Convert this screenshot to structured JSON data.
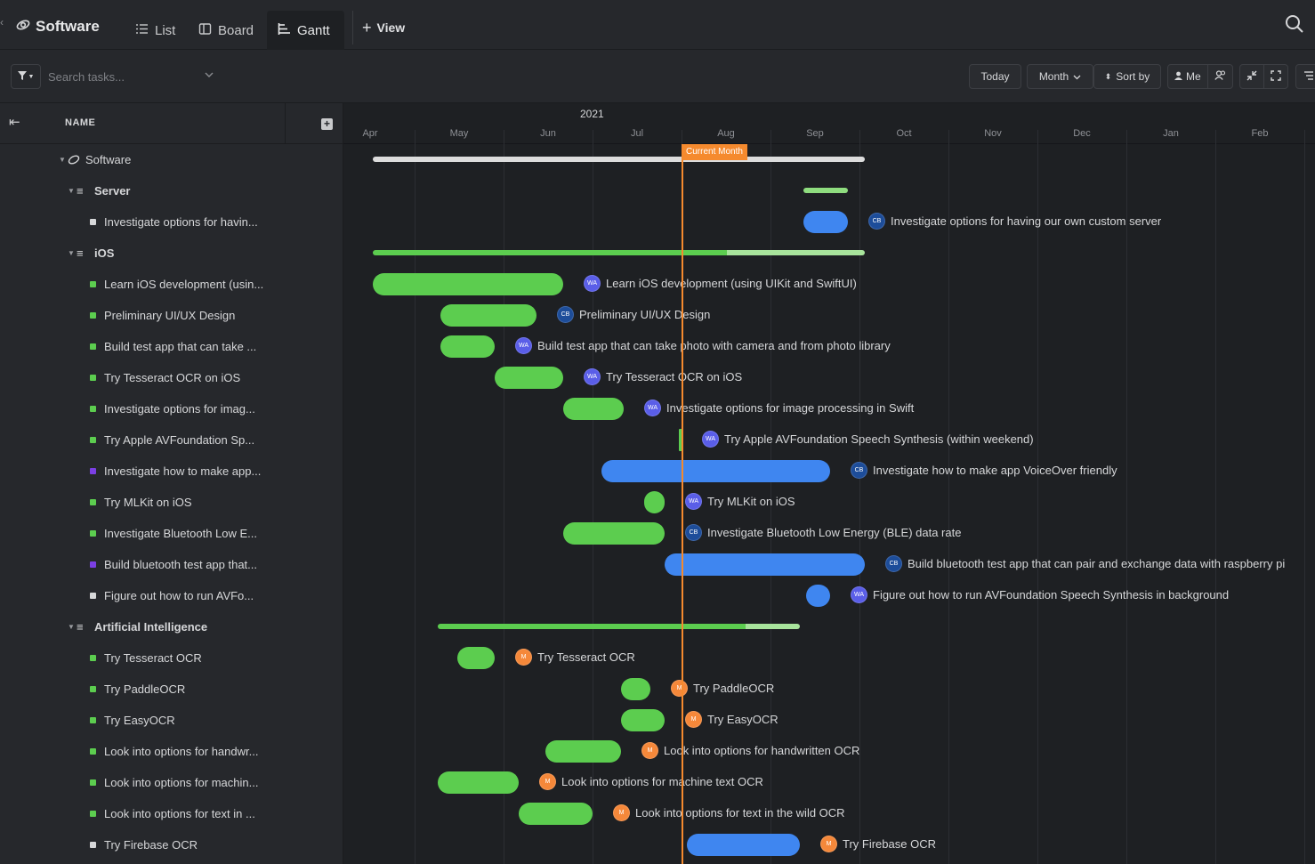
{
  "app": {
    "title": "Software",
    "tabs": [
      {
        "label": "List"
      },
      {
        "label": "Board"
      },
      {
        "label": "Gantt"
      }
    ],
    "add_view_label": "View"
  },
  "toolbar": {
    "search_placeholder": "Search tasks...",
    "today_label": "Today",
    "zoom_label": "Month",
    "sort_label": "Sort by",
    "me_label": "Me"
  },
  "list_header": {
    "name_column": "NAME"
  },
  "colors": {
    "done_green": "#5ccd4f",
    "in_progress_blue": "#3f86f0",
    "todo_grey": "#d6d7d9",
    "purple": "#7b3fe4",
    "today_orange": "#f58a2e"
  },
  "timeline": {
    "year": "2021",
    "months": [
      "Apr",
      "May",
      "Jun",
      "Jul",
      "Aug",
      "Sep",
      "Oct",
      "Nov",
      "Dec",
      "Jan",
      "Feb"
    ],
    "current_marker": "Current Month"
  },
  "rows": [
    {
      "name": "Software",
      "type": "space",
      "progress": 0.63
    },
    {
      "name": "Server",
      "type": "list",
      "progress": 0
    },
    {
      "name": "Investigate options for havin...",
      "full": "Investigate options for having our own custom server",
      "status": "todo",
      "assignee": "CB"
    },
    {
      "name": "iOS",
      "type": "list",
      "progress": 0.72
    },
    {
      "name": "Learn iOS development (usin...",
      "full": "Learn iOS development (using UIKit and SwiftUI)",
      "status": "done",
      "assignee": "WA"
    },
    {
      "name": "Preliminary UI/UX Design",
      "full": "Preliminary UI/UX Design",
      "status": "done",
      "assignee": "CB"
    },
    {
      "name": "Build test app that can take ...",
      "full": "Build test app that can take photo with camera and from photo library",
      "status": "done",
      "assignee": "WA"
    },
    {
      "name": "Try Tesseract OCR on iOS",
      "full": "Try Tesseract OCR on iOS",
      "status": "done",
      "assignee": "WA"
    },
    {
      "name": "Investigate options for imag...",
      "full": "Investigate options for image processing in Swift",
      "status": "done",
      "assignee": "WA"
    },
    {
      "name": "Try Apple AVFoundation Sp...",
      "full": "Try Apple AVFoundation Speech Synthesis (within weekend)",
      "status": "done",
      "assignee": "WA"
    },
    {
      "name": "Investigate how to make app...",
      "full": "Investigate how to make app VoiceOver friendly",
      "status": "progress",
      "assignee": "CB"
    },
    {
      "name": "Try MLKit on iOS",
      "full": "Try MLKit on iOS",
      "status": "done",
      "assignee": "WA"
    },
    {
      "name": "Investigate Bluetooth Low E...",
      "full": "Investigate Bluetooth Low Energy (BLE) data rate",
      "status": "done",
      "assignee": "CB"
    },
    {
      "name": "Build bluetooth test app that...",
      "full": "Build bluetooth test app that can pair and exchange data with raspberry pi",
      "status": "progress",
      "assignee": "CB"
    },
    {
      "name": "Figure out how to run AVFo...",
      "full": "Figure out how to run AVFoundation Speech Synthesis in background",
      "status": "todo",
      "assignee": "WA"
    },
    {
      "name": "Artificial Intelligence",
      "type": "list",
      "progress": 0.85
    },
    {
      "name": "Try Tesseract OCR",
      "full": "Try Tesseract OCR",
      "status": "done",
      "assignee": "M"
    },
    {
      "name": "Try PaddleOCR",
      "full": "Try PaddleOCR",
      "status": "done",
      "assignee": "M"
    },
    {
      "name": "Try EasyOCR",
      "full": "Try EasyOCR",
      "status": "done",
      "assignee": "M"
    },
    {
      "name": "Look into options for handwr...",
      "full": "Look into options for handwritten OCR",
      "status": "done",
      "assignee": "M"
    },
    {
      "name": "Look into options for machin...",
      "full": "Look into options for machine text OCR",
      "status": "done",
      "assignee": "M"
    },
    {
      "name": "Look into options for text in ...",
      "full": "Look into options for text in the wild OCR",
      "status": "done",
      "assignee": "M"
    },
    {
      "name": "Try Firebase OCR",
      "full": "Try Firebase OCR",
      "status": "todo",
      "assignee": "M"
    }
  ]
}
